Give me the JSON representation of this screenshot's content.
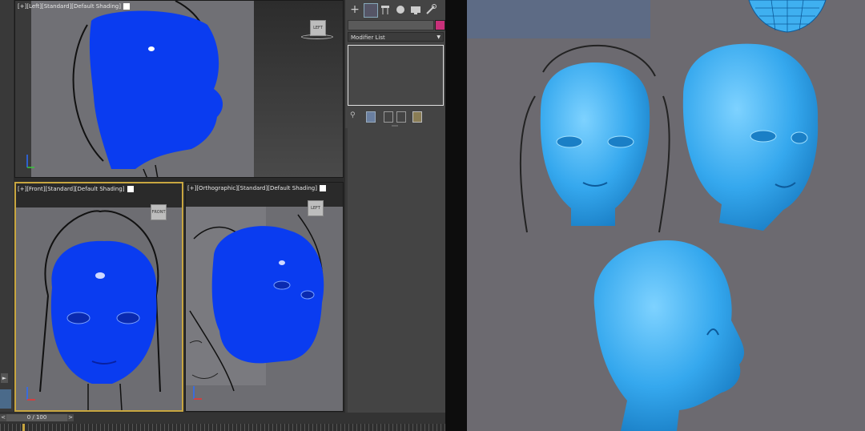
{
  "viewports": {
    "left": {
      "label": "[+][Left][Standard][Default Shading]",
      "cube_label": "LEFT"
    },
    "front": {
      "label": "[+][Front][Standard][Default Shading]",
      "cube_label": "FRONT"
    },
    "ortho": {
      "label": "[+][Orthographic][Standard][Default Shading]",
      "cube_label": "LEFT"
    }
  },
  "command_panel": {
    "tabs": [
      "create-icon",
      "modify-icon",
      "hierarchy-icon",
      "motion-icon",
      "display-icon",
      "utilities-icon"
    ],
    "modifier_list_label": "Modifier List",
    "color_swatch": "#c8307a"
  },
  "timeline": {
    "frame_counter": "0 / 100",
    "prev": "<",
    "next": ">"
  },
  "colors": {
    "head_blue": "#0a3cf0",
    "reference_blue": "#3fb0f0",
    "viewport_bg": "#6b6b70",
    "panel_bg": "#444444"
  }
}
